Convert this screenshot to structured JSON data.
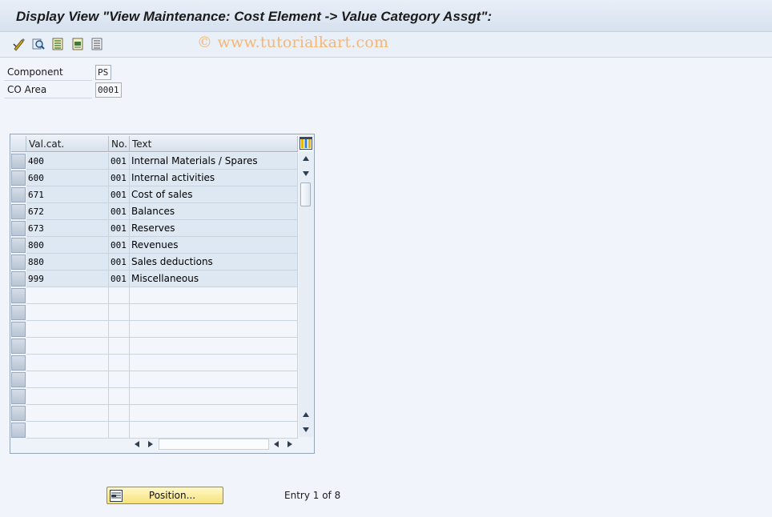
{
  "window": {
    "title": "Display View \"View Maintenance: Cost Element -> Value Category Assgt\":"
  },
  "toolbar": {
    "icons": [
      "display-change-icon",
      "find-icon",
      "select-all-icon",
      "select-block-icon",
      "deselect-all-icon"
    ]
  },
  "watermark": "© www.tutorialkart.com",
  "fields": {
    "component": {
      "label": "Component",
      "value": "PS"
    },
    "co_area": {
      "label": "CO Area",
      "value": "0001"
    }
  },
  "table": {
    "columns": [
      "Val.cat.",
      "No.",
      "Text"
    ],
    "rows": [
      {
        "valcat": "400",
        "no": "001",
        "text": "Internal Materials / Spares"
      },
      {
        "valcat": "600",
        "no": "001",
        "text": "Internal activities"
      },
      {
        "valcat": "671",
        "no": "001",
        "text": "Cost of sales"
      },
      {
        "valcat": "672",
        "no": "001",
        "text": "Balances"
      },
      {
        "valcat": "673",
        "no": "001",
        "text": "Reserves"
      },
      {
        "valcat": "800",
        "no": "001",
        "text": "Revenues"
      },
      {
        "valcat": "880",
        "no": "001",
        "text": "Sales deductions"
      },
      {
        "valcat": "999",
        "no": "001",
        "text": "Miscellaneous"
      }
    ],
    "empty_rows": 9
  },
  "footer": {
    "position_button": "Position...",
    "entry_info": "Entry 1 of 8"
  },
  "colors": {
    "accent_button": "#f6e27a",
    "filled_row": "#dde8f3",
    "background": "#f1f5fb"
  }
}
